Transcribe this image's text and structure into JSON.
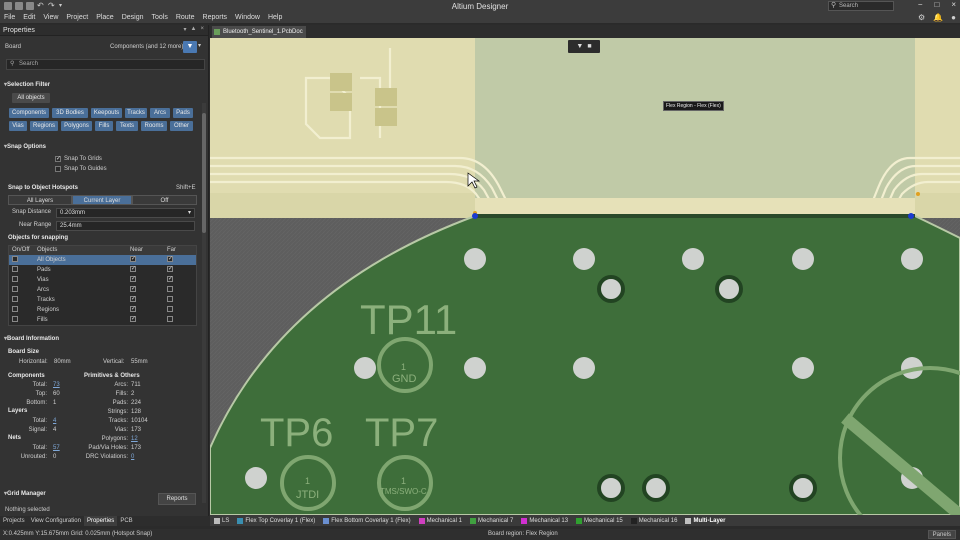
{
  "app": {
    "title": "Altium Designer",
    "search_placeholder": "Search",
    "window_controls": [
      "−",
      "□",
      "×"
    ]
  },
  "menu": [
    "File",
    "Edit",
    "View",
    "Project",
    "Place",
    "Design",
    "Tools",
    "Route",
    "Reports",
    "Window",
    "Help"
  ],
  "properties": {
    "title": "Properties",
    "object_kind": "Board",
    "filter_summary": "Components (and 12 more)",
    "search_placeholder": "Search",
    "selection_filter": {
      "heading": "Selection Filter",
      "all_objects": "All objects",
      "row1": [
        "Components",
        "3D Bodies",
        "Keepouts",
        "Tracks",
        "Arcs",
        "Pads"
      ],
      "row2": [
        "Vias",
        "Regions",
        "Polygons",
        "Fills",
        "Texts",
        "Rooms",
        "Other"
      ]
    },
    "snap_options": {
      "heading": "Snap Options",
      "snap_to_grids": "Snap To Grids",
      "snap_to_guides": "Snap To Guides"
    },
    "hotspots": {
      "heading": "Snap to Object Hotspots",
      "shortcut": "Shift+E",
      "modes": [
        "All Layers",
        "Current Layer",
        "Off"
      ],
      "active_mode": "Current Layer",
      "snap_distance_label": "Snap Distance",
      "snap_distance": "0.203mm",
      "near_range_label": "Near Range",
      "near_range": "25.4mm"
    },
    "objects_for_snapping": {
      "heading": "Objects for snapping",
      "columns": [
        "On/Off",
        "Objects",
        "Near",
        "Far"
      ],
      "rows": [
        {
          "name": "All Objects",
          "near": true,
          "far": true,
          "selected": true
        },
        {
          "name": "Pads",
          "near": true,
          "far": true
        },
        {
          "name": "Vias",
          "near": true,
          "far": true
        },
        {
          "name": "Arcs",
          "near": true,
          "far": false
        },
        {
          "name": "Tracks",
          "near": true,
          "far": false
        },
        {
          "name": "Regions",
          "near": true,
          "far": false
        },
        {
          "name": "Fills",
          "near": true,
          "far": false
        }
      ]
    },
    "board_information": {
      "heading": "Board Information",
      "board_size_heading": "Board Size",
      "horizontal_label": "Horizontal:",
      "horizontal": "80mm",
      "vertical_label": "Vertical:",
      "vertical": "55mm",
      "components_heading": "Components",
      "components": [
        [
          "Total:",
          "73"
        ],
        [
          "Top:",
          "60"
        ],
        [
          "Bottom:",
          "1"
        ]
      ],
      "layers_heading": "Layers",
      "layers": [
        [
          "Total:",
          "4"
        ],
        [
          "Signal:",
          "4"
        ]
      ],
      "nets_heading": "Nets",
      "nets": [
        [
          "Total:",
          "57"
        ],
        [
          "Unrouted:",
          "0"
        ]
      ],
      "primitives_heading": "Primitives & Others",
      "primitives": [
        [
          "Arcs:",
          "711"
        ],
        [
          "Fills:",
          "2"
        ],
        [
          "Pads:",
          "224"
        ],
        [
          "Strings:",
          "128"
        ],
        [
          "Tracks:",
          "10104"
        ],
        [
          "Vias:",
          "173"
        ],
        [
          "Polygons:",
          "12"
        ],
        [
          "Pad/Via Holes:",
          "173"
        ],
        [
          "DRC Violations:",
          "0"
        ]
      ],
      "reports_button": "Reports"
    },
    "grid_manager": "Grid Manager",
    "selection_status": "Nothing selected"
  },
  "panel_tabs": [
    "Projects",
    "View Configuration",
    "Properties",
    "PCB"
  ],
  "active_panel_tab": "Properties",
  "document_tab": "Bluetooth_Sentinel_1.PcbDoc *",
  "canvas": {
    "tooltip": "Flex Region - Flex (Flex)",
    "silkscreen": [
      "TP11",
      "TP6",
      "TP7",
      "GND",
      "JTDI",
      "TMS/SWO-C",
      "1",
      "1",
      "1"
    ]
  },
  "layers": [
    {
      "name": "LS",
      "color": "#bbbbbb"
    },
    {
      "name": "Flex Top Coverlay 1 (Flex)",
      "color": "#3a8fb0"
    },
    {
      "name": "Flex Bottom Coverlay 1 (Flex)",
      "color": "#6a8fd0"
    },
    {
      "name": "Mechanical 1",
      "color": "#d040c0"
    },
    {
      "name": "Mechanical 7",
      "color": "#40a040"
    },
    {
      "name": "Mechanical 13",
      "color": "#d030d0"
    },
    {
      "name": "Mechanical 15",
      "color": "#30a030"
    },
    {
      "name": "Mechanical 16",
      "color": "#222222"
    },
    {
      "name": "Multi-Layer",
      "color": "#c0c0c0"
    }
  ],
  "active_layer": "Multi-Layer",
  "status": {
    "coords": "X:0.425mm Y:15.675mm   Grid: 0.025mm   (Hotspot Snap)",
    "center": "Board region: Flex Region",
    "panels": "Panels"
  }
}
